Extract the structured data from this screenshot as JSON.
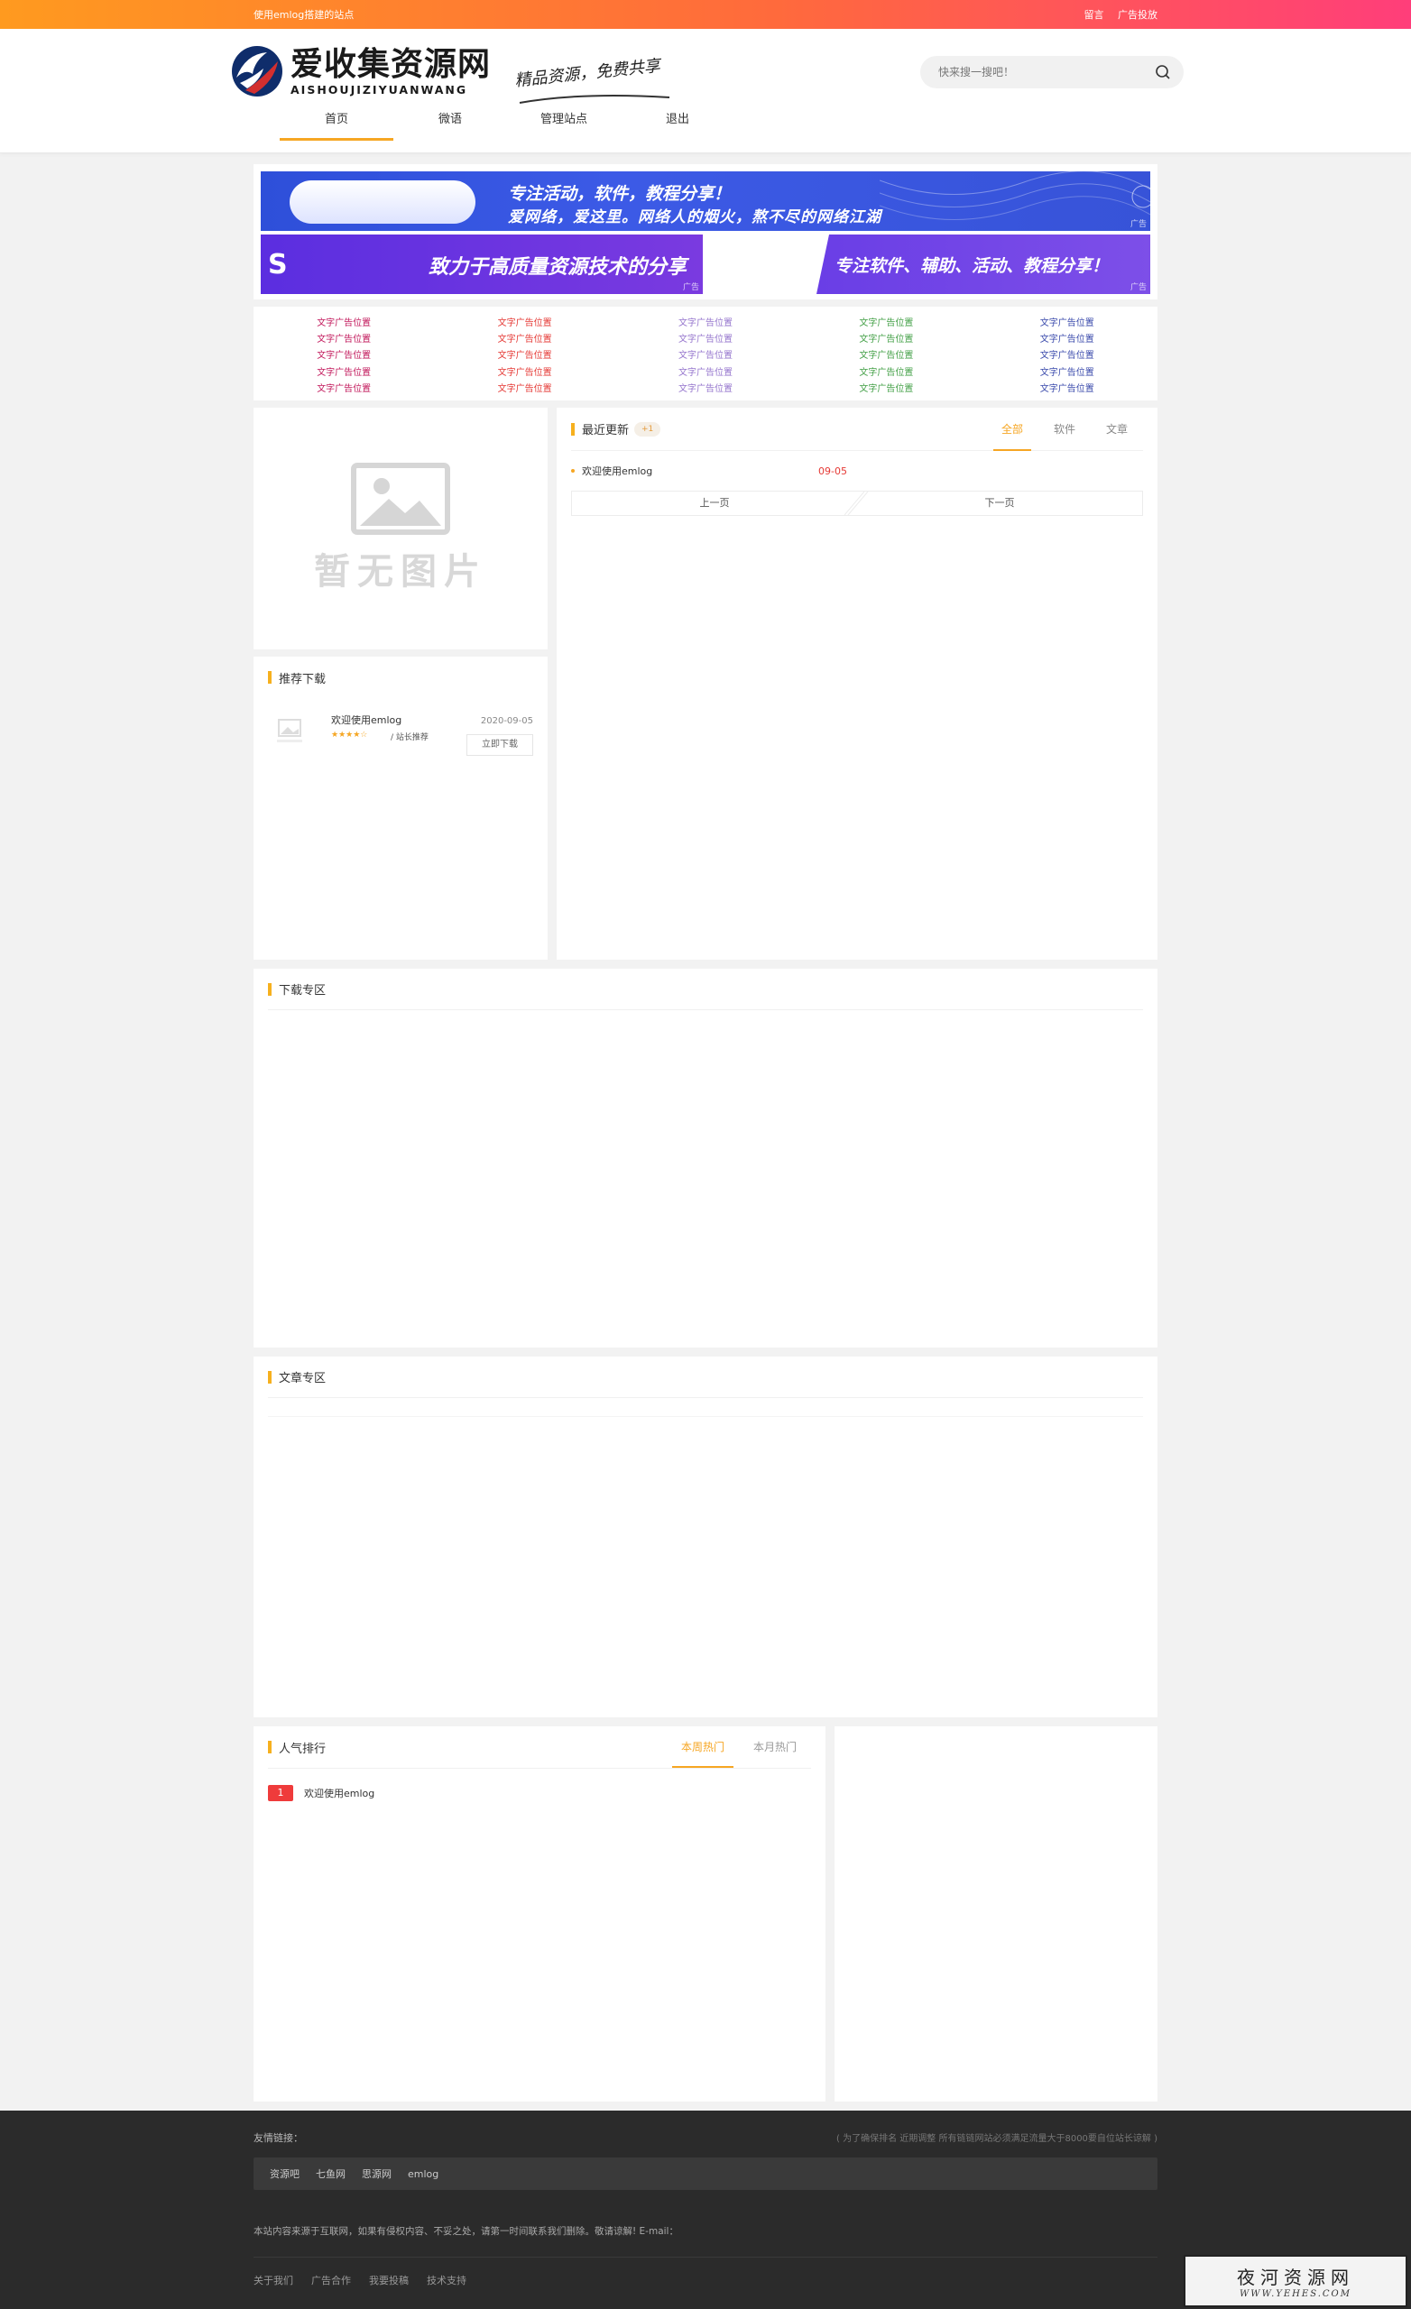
{
  "topbar": {
    "welcome": "使用emlog搭建的站点",
    "links": [
      "留言",
      "广告投放"
    ]
  },
  "header": {
    "logo_cn": "爱收集资源网",
    "logo_en": "AISHOUJIZIYUANWANG",
    "slogan": "精品资源，免费共享",
    "search_placeholder": "快来搜一搜吧！",
    "nav": [
      {
        "label": "首页",
        "active": true
      },
      {
        "label": "微语",
        "active": false
      },
      {
        "label": "管理站点",
        "active": false
      },
      {
        "label": "退出",
        "active": false
      }
    ]
  },
  "banners": {
    "b1_line1": "专注活动，软件，教程分享！",
    "b1_line2": "爱网络，爱这里。网络人的烟火，熬不尽的网络江湖",
    "b2_left": "致力于高质量资源技术的分享",
    "b2_right": "专注软件、辅助、活动、教程分享！",
    "ad_tag": "广告"
  },
  "text_ads": {
    "label": "文字广告位置",
    "rows": 5,
    "colors": [
      "#c2185b",
      "#e53935",
      "#9575cd",
      "#43a047",
      "#3949ab"
    ]
  },
  "noimage": {
    "text": "暂无图片"
  },
  "recommend": {
    "title": "推荐下载",
    "items": [
      {
        "name": "欢迎使用emlog",
        "stars": "★★★★☆",
        "tag": "/ 站长推荐",
        "date": "2020-09-05",
        "button": "立即下载"
      }
    ]
  },
  "recent": {
    "title": "最近更新",
    "badge": "+1",
    "tabs": [
      {
        "label": "全部",
        "active": true
      },
      {
        "label": "软件",
        "active": false
      },
      {
        "label": "文章",
        "active": false
      }
    ],
    "posts": [
      {
        "title": "欢迎使用emlog",
        "date": "09-05"
      }
    ],
    "prev": "上一页",
    "next": "下一页"
  },
  "sections": {
    "download": "下载专区",
    "article": "文章专区"
  },
  "hot": {
    "title": "人气排行",
    "tabs": [
      {
        "label": "本周热门",
        "active": true
      },
      {
        "label": "本月热门",
        "active": false
      }
    ],
    "items": [
      {
        "rank": "1",
        "title": "欢迎使用emlog"
      }
    ]
  },
  "footer": {
    "links_label": "友情链接：",
    "links_note": "( 为了确保排名 近期调整 所有链链网站必须满足流量大于8000要自位站长谅解 )",
    "links": [
      "资源吧",
      "七鱼网",
      "思源网",
      "emlog"
    ],
    "disclaimer": "本站内容来源于互联网，如果有侵权内容、不妥之处，请第一时间联系我们删除。敬请谅解! E-mail：",
    "bottom_links": [
      "关于我们",
      "广告合作",
      "我要投稿",
      "技术支持"
    ]
  },
  "watermark": {
    "line1": "夜河资源网",
    "line2": "WWW.YEHES.COM"
  },
  "colors": {
    "accent": "#f6a623",
    "topbar_start": "#ff9a1f",
    "topbar_end": "#ff3e7a",
    "rank_red": "#ef3b3b"
  }
}
